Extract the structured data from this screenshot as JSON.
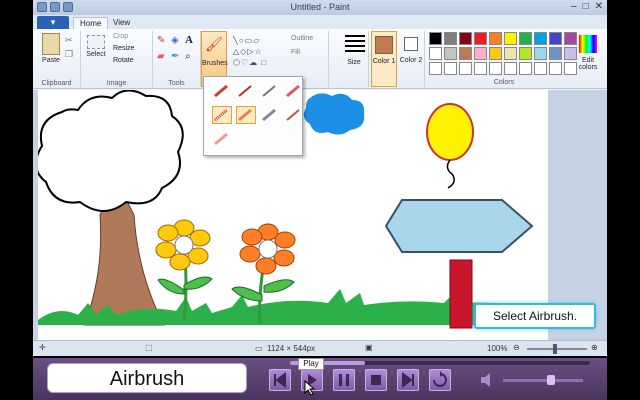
{
  "window": {
    "title": "Untitled - Paint"
  },
  "tabs": {
    "file": "",
    "home": "Home",
    "view": "View"
  },
  "ribbon": {
    "clipboard": {
      "label": "Clipboard",
      "paste": "Paste",
      "cut_icon": "scissors-icon",
      "copy_icon": "copy-icon"
    },
    "image": {
      "label": "Image",
      "select": "Select",
      "crop": "Crop",
      "resize": "Resize",
      "rotate": "Rotate"
    },
    "tools": {
      "label": "Tools"
    },
    "brushes": {
      "label": "Brushes"
    },
    "shapes": {
      "outline": "Outline",
      "fill": "Fill"
    },
    "size": {
      "label": "Size"
    },
    "colors": {
      "label": "Colors",
      "color1": "Color 1",
      "color2": "Color 2",
      "edit": "Edit colors",
      "color1_value": "#c47a4a",
      "color2_value": "#ffffff"
    }
  },
  "palette": [
    "#000000",
    "#7f7f7f",
    "#880015",
    "#ed1c24",
    "#ff7f27",
    "#fff200",
    "#22b14c",
    "#00a2e8",
    "#3f48cc",
    "#a349a4",
    "#ffffff",
    "#c3c3c3",
    "#b97a57",
    "#ffaec9",
    "#ffc90e",
    "#efe4b0",
    "#b5e61d",
    "#99d9ea",
    "#7092be",
    "#c8bfe7",
    "#ffffff",
    "#ffffff",
    "#ffffff",
    "#ffffff",
    "#ffffff",
    "#ffffff",
    "#ffffff",
    "#ffffff",
    "#ffffff",
    "#ffffff"
  ],
  "status": {
    "dimensions": "1124 × 544px",
    "zoom": "100%"
  },
  "tooltip": {
    "text": "Select Airbrush."
  },
  "player": {
    "caption": "Airbrush",
    "play_tip": "Play",
    "progress": 0.25
  }
}
